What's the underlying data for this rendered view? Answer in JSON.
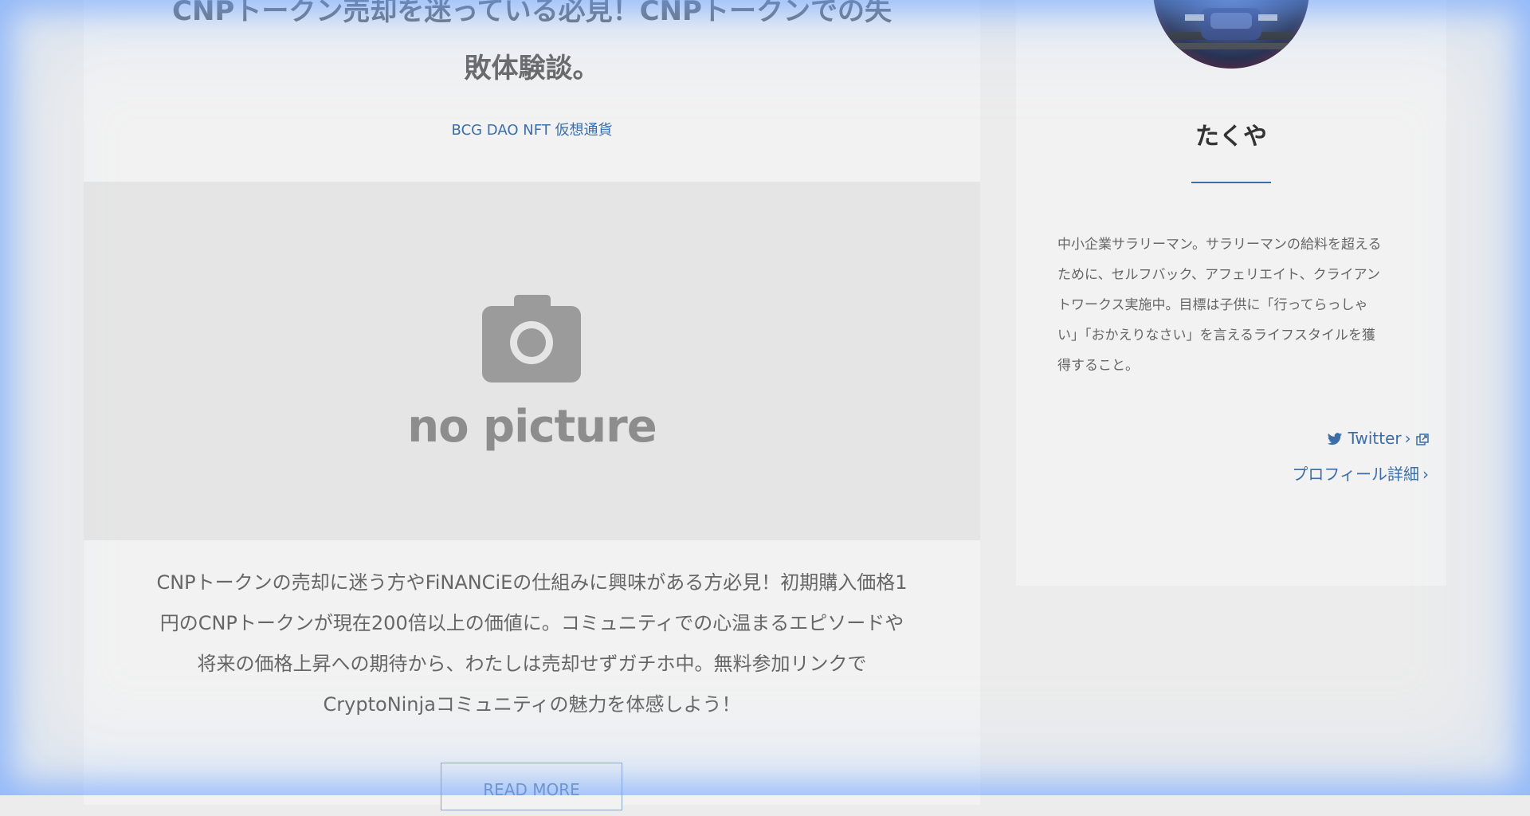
{
  "article": {
    "title_line1": "CNPトークン売却を迷っている必見！CNPトークンでの失",
    "title_line2": "敗体験談。",
    "tags": "BCG DAO NFT 仮想通貨",
    "thumbnail_text": "no picture",
    "excerpt_line1": "CNPトークンの売却に迷う方やFiNANCiEの仕組みに興味がある方必見！初期購入価格1",
    "excerpt_line2": "円のCNPトークンが現在200倍以上の価値に。コミュニティでの心温まるエピソードや",
    "excerpt_line3": "将来の価格上昇への期待から、わたしは売却せずガチホ中。無料参加リンクで",
    "excerpt_line4": "CryptoNinjaコミュニティの魅力を体感しよう！",
    "read_more": "READ MORE"
  },
  "sidebar": {
    "author_name": "たくや",
    "bio_line1": "中小企業サラリーマン。サラリーマンの給料を超える",
    "bio_line2": "ために、セルフバック、アフェリエイト、クライアン",
    "bio_line3": "トワークス実施中。目標は子供に「行ってらっしゃ",
    "bio_line4": "い」「おかえりなさい」を言えるライフスタイルを獲",
    "bio_line5": "得すること。",
    "twitter_label": "Twitter",
    "profile_label": "プロフィール詳細",
    "twitter_icon": "twitter-bird-icon",
    "external_icon": "external-link-icon"
  },
  "colors": {
    "link": "#3b6ea8",
    "card_bg": "#f2f2f2",
    "page_bg": "#ececec",
    "thumb_bg": "#e5e5e5"
  }
}
